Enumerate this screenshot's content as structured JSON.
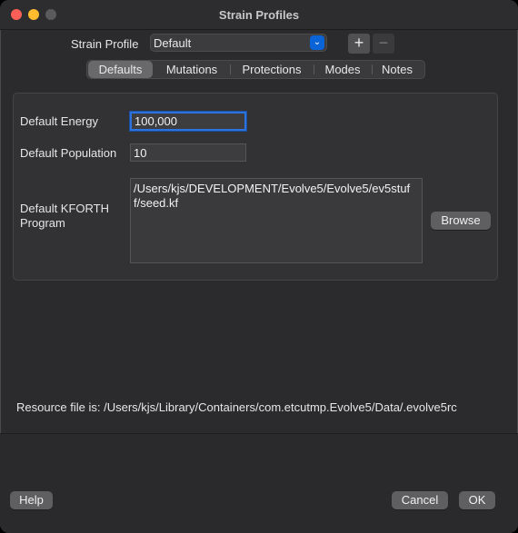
{
  "window": {
    "title": "Strain Profiles"
  },
  "profile": {
    "label": "Strain Profile",
    "selected": "Default",
    "add_symbol": "+",
    "remove_symbol": "−"
  },
  "tabs": [
    {
      "label": "Defaults",
      "active": true
    },
    {
      "label": "Mutations",
      "active": false
    },
    {
      "label": "Protections",
      "active": false
    },
    {
      "label": "Modes",
      "active": false
    },
    {
      "label": "Notes",
      "active": false
    }
  ],
  "defaults": {
    "energy_label": "Default Energy",
    "energy_value": "100,000",
    "population_label": "Default Population",
    "population_value": "10",
    "program_label_line1": "Default KFORTH",
    "program_label_line2": "Program",
    "program_path": "/Users/kjs/DEVELOPMENT/Evolve5/Evolve5/ev5stuff/seed.kf",
    "browse_label": "Browse"
  },
  "resource": {
    "text": "Resource file is: /Users/kjs/Library/Containers/com.etcutmp.Evolve5/Data/.evolve5rc"
  },
  "footer": {
    "help_label": "Help",
    "cancel_label": "Cancel",
    "ok_label": "OK"
  },
  "colors": {
    "accent": "#0a64d8",
    "close": "#ff5f57",
    "minimize": "#febc2e"
  }
}
